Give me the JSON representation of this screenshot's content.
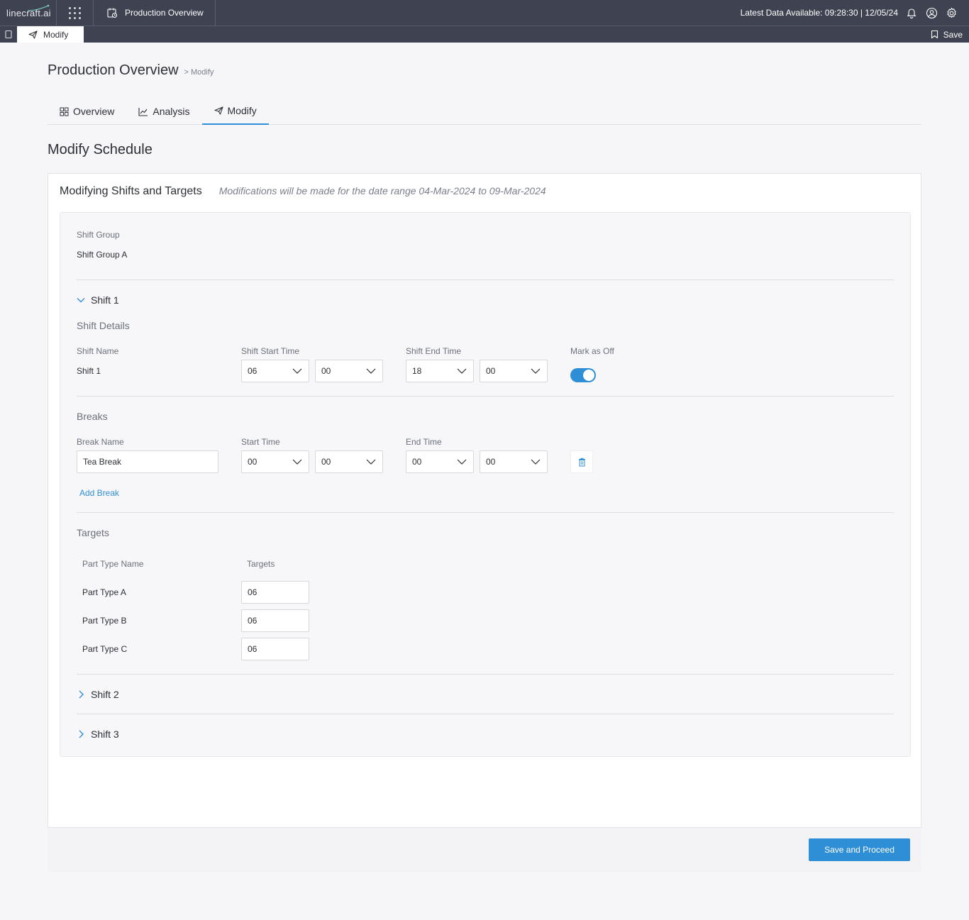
{
  "topbar": {
    "logo_text": "linecraft.ai",
    "app_title": "Production Overview",
    "latest_data": "Latest Data Available: 09:28:30 | 12/05/24"
  },
  "subbar": {
    "active_tab": "Modify",
    "save_label": "Save"
  },
  "header": {
    "title": "Production Overview",
    "breadcrumb": "> Modify"
  },
  "tabs": [
    {
      "label": "Overview",
      "icon": "grid-icon"
    },
    {
      "label": "Analysis",
      "icon": "line-chart-icon"
    },
    {
      "label": "Modify",
      "icon": "send-icon",
      "active": true
    }
  ],
  "section_title": "Modify Schedule",
  "card": {
    "title": "Modifying Shifts and Targets",
    "note": "Modifications will be made for the date range 04-Mar-2024 to 09-Mar-2024"
  },
  "shift_group": {
    "label": "Shift Group",
    "value": "Shift Group A"
  },
  "shift1": {
    "title": "Shift 1",
    "details_heading": "Shift Details",
    "name_label": "Shift Name",
    "name_value": "Shift 1",
    "start_label": "Shift Start Time",
    "start_hour": "06",
    "start_min": "00",
    "end_label": "Shift End Time",
    "end_hour": "18",
    "end_min": "00",
    "off_label": "Mark as Off",
    "off_enabled": true
  },
  "breaks": {
    "heading": "Breaks",
    "name_label": "Break Name",
    "start_label": "Start Time",
    "end_label": "End Time",
    "items": [
      {
        "name": "Tea Break",
        "start_hour": "00",
        "start_min": "00",
        "end_hour": "00",
        "end_min": "00"
      }
    ],
    "add_label": "Add Break"
  },
  "targets": {
    "heading": "Targets",
    "col_part": "Part Type Name",
    "col_target": "Targets",
    "rows": [
      {
        "part": "Part Type A",
        "target": "06"
      },
      {
        "part": "Part Type B",
        "target": "06"
      },
      {
        "part": "Part Type C",
        "target": "06"
      }
    ]
  },
  "collapsed_shifts": [
    "Shift 2",
    "Shift 3"
  ],
  "actions": {
    "save_proceed": "Save and Proceed"
  },
  "colors": {
    "topbar": "#3f4250",
    "accent": "#2f8fd6",
    "background": "#f6f6f8"
  }
}
